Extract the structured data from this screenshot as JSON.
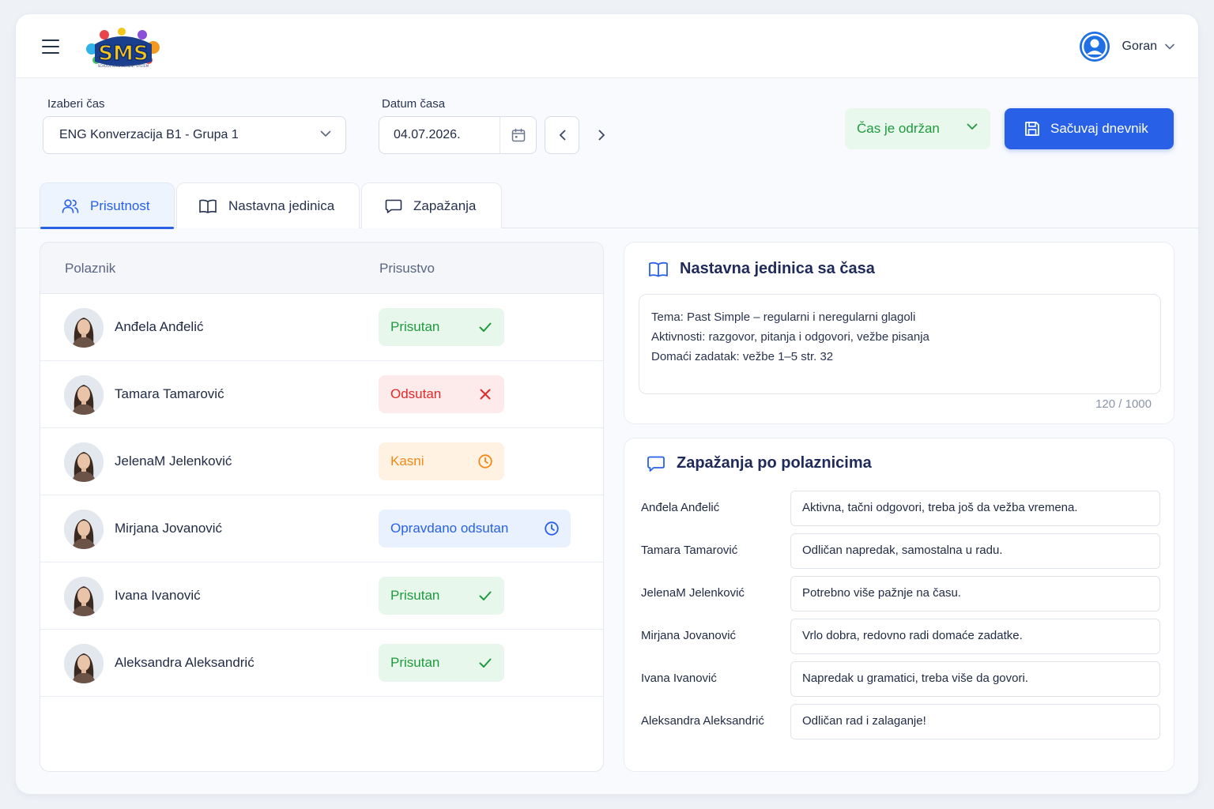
{
  "header": {
    "user_name": "Goran"
  },
  "controls": {
    "class_label": "Izaberi čas",
    "class_value": "ENG Konverzacija B1 - Grupa 1",
    "date_label": "Datum časa",
    "date_value": "04.07.2026.",
    "lesson_status": "Čas je održan",
    "save_label": "Sačuvaj dnevnik"
  },
  "tabs": [
    {
      "label": "Prisutnost",
      "active": true
    },
    {
      "label": "Nastavna jedinica",
      "active": false
    },
    {
      "label": "Zapažanja",
      "active": false
    }
  ],
  "attendance": {
    "col_student": "Polaznik",
    "col_presence": "Prisustvo",
    "rows": [
      {
        "name": "Anđela Anđelić",
        "status": "Prisutan",
        "status_type": "present",
        "status_icon": "check-icon"
      },
      {
        "name": "Tamara Tamarović",
        "status": "Odsutan",
        "status_type": "absent",
        "status_icon": "x-icon"
      },
      {
        "name": "JelenaM Jelenković",
        "status": "Kasni",
        "status_type": "late",
        "status_icon": "clock-icon"
      },
      {
        "name": "Mirjana Jovanović",
        "status": "Opravdano odsutan",
        "status_type": "excused",
        "status_icon": "clock-icon"
      },
      {
        "name": "Ivana Ivanović",
        "status": "Prisutan",
        "status_type": "present",
        "status_icon": "check-icon"
      },
      {
        "name": "Aleksandra Aleksandrić",
        "status": "Prisutan",
        "status_type": "present",
        "status_icon": "check-icon"
      }
    ]
  },
  "lesson": {
    "title": "Nastavna jedinica sa časa",
    "lines": [
      "Tema: Past Simple – regularni i neregularni glagoli",
      "Aktivnosti: razgovor, pitanja i odgovori, vežbe pisanja",
      "Domaći zadatak: vežbe 1–5 str. 32"
    ],
    "counter": "120 / 1000"
  },
  "observations": {
    "title": "Zapažanja po polaznicima",
    "rows": [
      {
        "name": "Anđela Anđelić",
        "note": "Aktivna, tačni odgovori, treba još da vežba vremena."
      },
      {
        "name": "Tamara Tamarović",
        "note": "Odličan napredak, samostalna u radu."
      },
      {
        "name": "JelenaM Jelenković",
        "note": "Potrebno više pažnje na času."
      },
      {
        "name": "Mirjana Jovanović",
        "note": "Vrlo dobra, redovno radi domaće zadatke."
      },
      {
        "name": "Ivana Ivanović",
        "note": "Napredak u gramatici, treba više da govori."
      },
      {
        "name": "Aleksandra Aleksandrić",
        "note": "Odličan rad i zalaganje!"
      }
    ]
  },
  "colors": {
    "accent": "#2860e8",
    "present": "#1f9a3f",
    "absent": "#e02a2a",
    "late": "#ef8a1a",
    "excused": "#2860e8"
  }
}
